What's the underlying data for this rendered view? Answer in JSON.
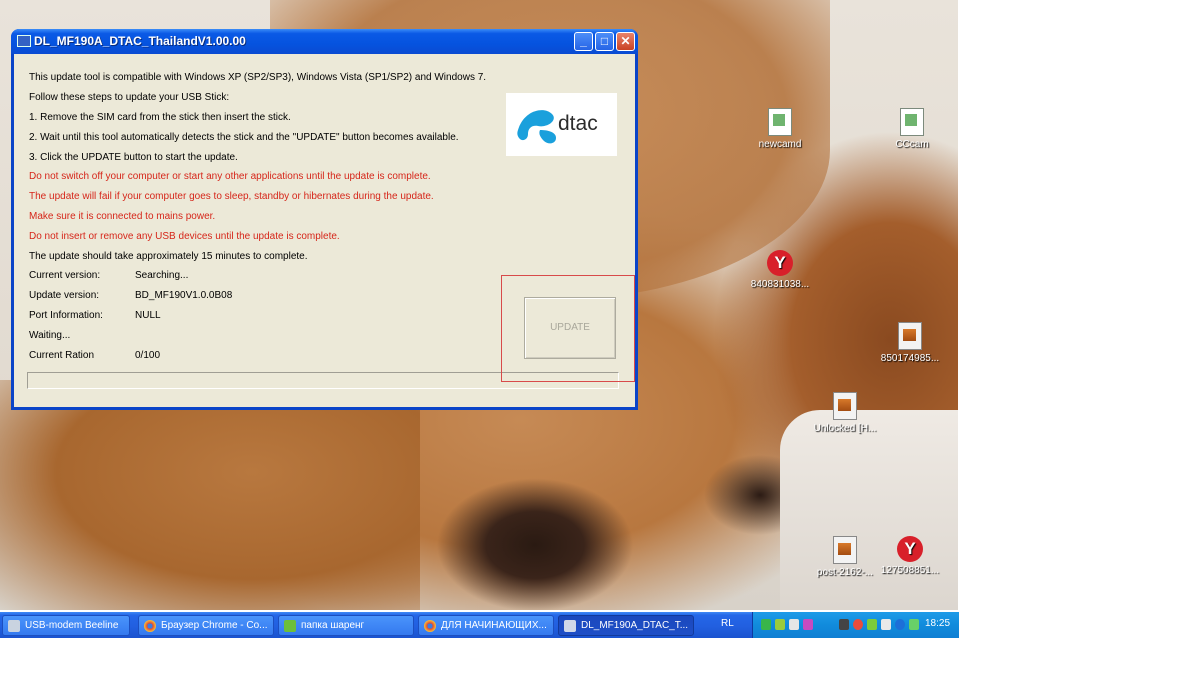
{
  "window": {
    "title": "DL_MF190A_DTAC_ThailandV1.00.00",
    "buttons": {
      "minimize": "_",
      "maximize": "□",
      "close": "✕"
    }
  },
  "content": {
    "line_compat": "This update tool is compatible with Windows XP (SP2/SP3), Windows Vista (SP1/SP2) and Windows 7.",
    "line_follow": "Follow these steps to update your USB Stick:",
    "step1": "1. Remove the SIM card from the stick then insert the stick.",
    "step2": "2. Wait until this tool automatically detects the stick and the \"UPDATE\" button becomes available.",
    "step3": "3. Click the UPDATE button to start the update.",
    "warn1": "Do not switch off your computer or start any other applications until the update is complete.",
    "warn2": "The update will fail if your computer goes to sleep, standby or hibernates during the update.",
    "warn3": "Make sure it is connected to mains power.",
    "warn4": "Do not insert or remove any USB devices until the update is complete.",
    "duration": "The update should take approximately 15 minutes to complete."
  },
  "status": {
    "current_version_label": "Current version:",
    "current_version_value": "Searching...",
    "update_version_label": "Update version:",
    "update_version_value": "BD_MF190V1.0.0B08",
    "port_label": "Port Information:",
    "port_value": "NULL",
    "waiting": "Waiting...",
    "ration_label": "Current Ration",
    "ration_value": "0/100",
    "progress": 0
  },
  "logo": {
    "text": "dtac",
    "color": "#1aa0dc"
  },
  "update_button": {
    "label": "UPDATE",
    "enabled": false
  },
  "desktop_icons": [
    {
      "label": "newcamd",
      "icon": "file-icon"
    },
    {
      "label": "CCcam",
      "icon": "file-icon"
    },
    {
      "label": "840831038...",
      "icon": "yandex-icon"
    },
    {
      "label": "850174985...",
      "icon": "archive-icon"
    },
    {
      "label": "Unlocked [H...",
      "icon": "archive-icon"
    },
    {
      "label": "post-2162-...",
      "icon": "archive-icon"
    },
    {
      "label": "127508851...",
      "icon": "yandex-icon"
    }
  ],
  "taskbar": {
    "items": [
      {
        "label": "USB-modem Beeline",
        "icon": "modem-icon"
      },
      {
        "label": "Браузер Chrome - Co...",
        "icon": "chrome-icon"
      },
      {
        "label": "папка шаренг",
        "icon": "folder-icon"
      },
      {
        "label": "ДЛЯ НАЧИНАЮЩИХ...",
        "icon": "chrome-icon"
      },
      {
        "label": "DL_MF190A_DTAC_T...",
        "icon": "app-icon",
        "active": true
      }
    ],
    "language": "RL",
    "clock": "18:25"
  }
}
